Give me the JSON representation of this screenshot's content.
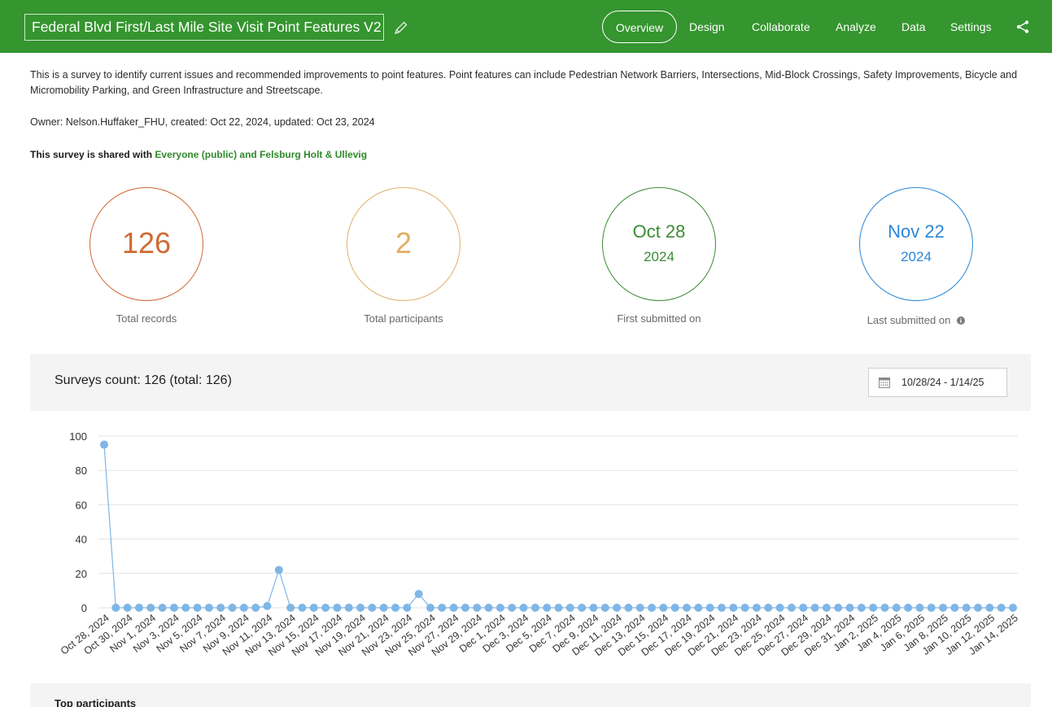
{
  "header": {
    "title": "Federal Blvd First/Last Mile Site Visit Point Features V2",
    "nav": {
      "overview": "Overview",
      "design": "Design",
      "collaborate": "Collaborate",
      "analyze": "Analyze",
      "data": "Data",
      "settings": "Settings"
    },
    "accent_color": "#35952f"
  },
  "description": "This is a survey to identify current issues and recommended improvements to point features. Point features can include Pedestrian Network Barriers, Intersections, Mid-Block Crossings, Safety Improvements, Bicycle and Micromobility Parking, and Green Infrastructure and Streetscape.",
  "owner_line": "Owner: Nelson.Huffaker_FHU, created: Oct 22, 2024, updated: Oct 23, 2024",
  "sharing": {
    "prefix": "This survey is shared with ",
    "groups": "Everyone (public) and Felsburg Holt & Ullevig"
  },
  "stats": {
    "total_records": {
      "value": "126",
      "label": "Total records",
      "color": "#cf6a34"
    },
    "total_participants": {
      "value": "2",
      "label": "Total participants",
      "color": "#e3ad62"
    },
    "first_submitted": {
      "line1": "Oct 28",
      "line2": "2024",
      "label": "First submitted on",
      "color": "#3a8c34"
    },
    "last_submitted": {
      "line1": "Nov 22",
      "line2": "2024",
      "label": "Last submitted on",
      "color": "#2a86d8"
    }
  },
  "chart_section": {
    "title": "Surveys count: 126 (total: 126)",
    "date_range": "10/28/24 - 1/14/25"
  },
  "bottom_section": {
    "title": "Top participants"
  },
  "chart_data": {
    "type": "line",
    "x_start": "2024-10-28",
    "x_end": "2025-01-14",
    "tick_labels": [
      "Oct 28, 2024",
      "Oct 30, 2024",
      "Nov 1, 2024",
      "Nov 3, 2024",
      "Nov 5, 2024",
      "Nov 7, 2024",
      "Nov 9, 2024",
      "Nov 11, 2024",
      "Nov 13, 2024",
      "Nov 15, 2024",
      "Nov 17, 2024",
      "Nov 19, 2024",
      "Nov 21, 2024",
      "Nov 23, 2024",
      "Nov 25, 2024",
      "Nov 27, 2024",
      "Nov 29, 2024",
      "Dec 1, 2024",
      "Dec 3, 2024",
      "Dec 5, 2024",
      "Dec 7, 2024",
      "Dec 9, 2024",
      "Dec 11, 2024",
      "Dec 13, 2024",
      "Dec 15, 2024",
      "Dec 17, 2024",
      "Dec 19, 2024",
      "Dec 21, 2024",
      "Dec 23, 2024",
      "Dec 25, 2024",
      "Dec 27, 2024",
      "Dec 29, 2024",
      "Dec 31, 2024",
      "Jan 2, 2025",
      "Jan 4, 2025",
      "Jan 6, 2025",
      "Jan 8, 2025",
      "Jan 10, 2025",
      "Jan 12, 2025",
      "Jan 14, 2025"
    ],
    "values": [
      95,
      0,
      0,
      0,
      0,
      0,
      0,
      0,
      0,
      0,
      0,
      0,
      0,
      0,
      1,
      22,
      0,
      0,
      0,
      0,
      0,
      0,
      0,
      0,
      0,
      0,
      0,
      8,
      0,
      0,
      0,
      0,
      0,
      0,
      0,
      0,
      0,
      0,
      0,
      0,
      0,
      0,
      0,
      0,
      0,
      0,
      0,
      0,
      0,
      0,
      0,
      0,
      0,
      0,
      0,
      0,
      0,
      0,
      0,
      0,
      0,
      0,
      0,
      0,
      0,
      0,
      0,
      0,
      0,
      0,
      0,
      0,
      0,
      0,
      0,
      0,
      0,
      0,
      0
    ],
    "ylim": [
      0,
      100
    ],
    "yticks": [
      0,
      20,
      40,
      60,
      80,
      100
    ],
    "grid": true,
    "color": "#7fb6e6"
  }
}
